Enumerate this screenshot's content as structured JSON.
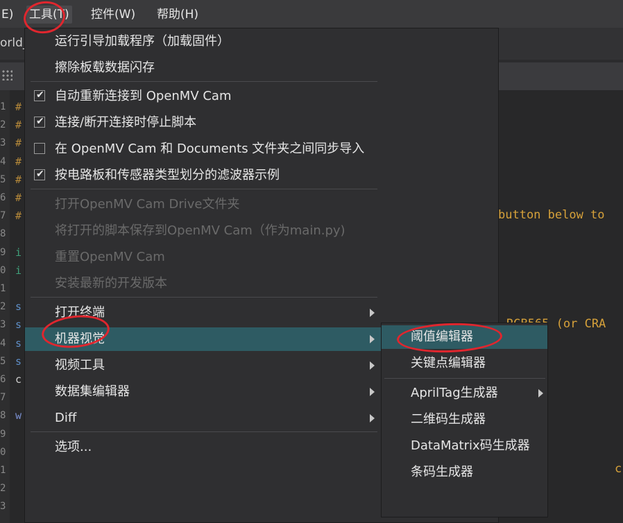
{
  "menubar": {
    "item0": "E)",
    "tools": "工具(T)",
    "widgets": "控件(W)",
    "help": "帮助(H)"
  },
  "editor": {
    "tab_fragment": "orld_",
    "line_numbers": [
      "1",
      "2",
      "3",
      "4",
      "5",
      "6",
      "7",
      "8",
      "9",
      "0",
      "1",
      "2",
      "3",
      "4",
      "5",
      "6",
      "7",
      "8",
      "9",
      "0",
      "1",
      "2",
      "3"
    ],
    "code_chars": [
      "#",
      "#",
      "#",
      "#",
      "#",
      "#",
      "#",
      "",
      "i",
      "i",
      "",
      "s",
      "s",
      "s",
      "s",
      "c",
      "",
      "w",
      "",
      "",
      "",
      "",
      ""
    ],
    "text_right_1": "button below to",
    "text_right_2": "RGB565 (or CRA",
    "text_right_3": "c"
  },
  "tools_menu": {
    "items": [
      {
        "label": "运行引导加载程序（加载固件）"
      },
      {
        "label": "擦除板载数据闪存"
      },
      {
        "label": "自动重新连接到 OpenMV Cam",
        "checked": true
      },
      {
        "label": "连接/断开连接时停止脚本",
        "checked": true
      },
      {
        "label": "在 OpenMV Cam 和 Documents 文件夹之间同步导入",
        "checked": false
      },
      {
        "label": "按电路板和传感器类型划分的滤波器示例",
        "checked": true
      },
      {
        "label": "打开OpenMV Cam Drive文件夹",
        "disabled": true
      },
      {
        "label": "将打开的脚本保存到OpenMV Cam（作为main.py)",
        "disabled": true
      },
      {
        "label": "重置OpenMV Cam",
        "disabled": true
      },
      {
        "label": "安装最新的开发版本",
        "disabled": true
      },
      {
        "label": "打开终端"
      },
      {
        "label": "机器视觉"
      },
      {
        "label": "视频工具"
      },
      {
        "label": "数据集编辑器"
      },
      {
        "label": "Diff"
      },
      {
        "label": "选项..."
      }
    ],
    "check_glyph": "✔"
  },
  "machine_vision_submenu": {
    "items": [
      {
        "label": "阈值编辑器"
      },
      {
        "label": "关键点编辑器"
      },
      {
        "label": "AprilTag生成器"
      },
      {
        "label": "二维码生成器"
      },
      {
        "label": "DataMatrix码生成器"
      },
      {
        "label": "条码生成器"
      }
    ]
  },
  "colors": {
    "highlight": "#2e5b63",
    "annotation": "#e0262e",
    "menu_bg": "#2f2f31"
  }
}
